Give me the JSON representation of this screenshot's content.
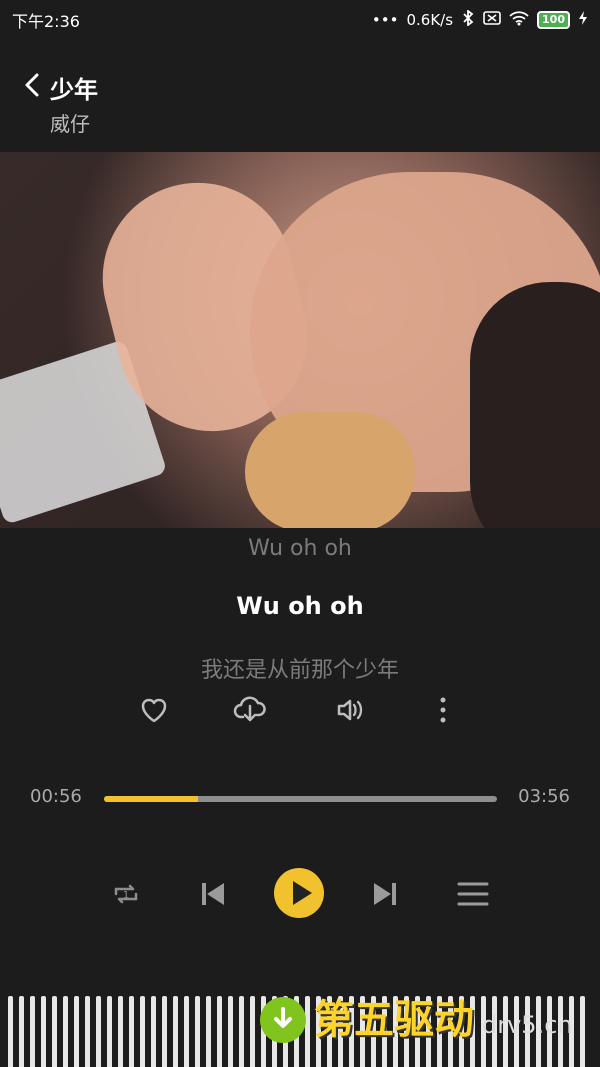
{
  "status": {
    "time": "下午2:36",
    "speed": "0.6K/s",
    "battery": "100"
  },
  "header": {
    "title": "少年",
    "artist": "威仔"
  },
  "lyrics": {
    "previous": "Wu oh oh",
    "current": "Wu oh oh",
    "next": "我还是从前那个少年"
  },
  "player": {
    "current_time": "00:56",
    "total_time": "03:56",
    "progress": 0.24,
    "accent": "#f2c12e"
  },
  "watermark": {
    "main": "第五驱动",
    "sub": "drv5.cn"
  }
}
